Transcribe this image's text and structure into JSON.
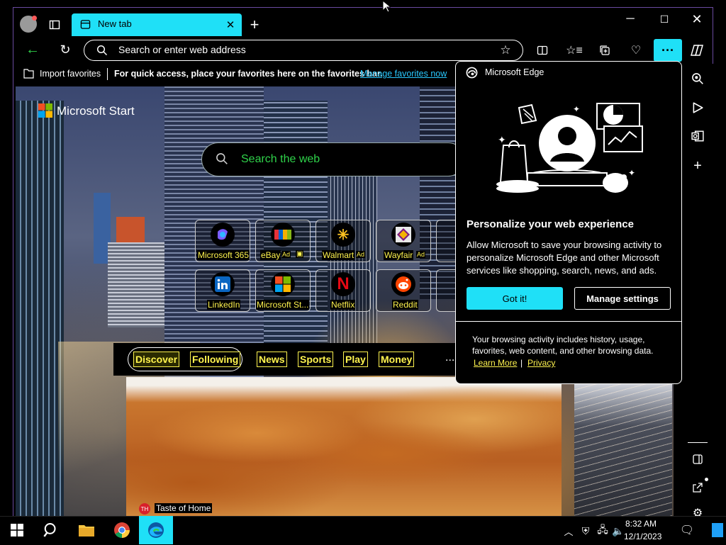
{
  "browser": {
    "tab_title": "New tab",
    "address_placeholder": "Search or enter web address"
  },
  "favorites_bar": {
    "import_label": "Import favorites",
    "message": "For quick access, place your favorites here on the favorites bar.",
    "manage_link": "Manage favorites now"
  },
  "start_page": {
    "brand": "Microsoft Start",
    "search_placeholder": "Search the web",
    "quick_links": [
      {
        "label": "Microsoft 365",
        "icon": "microsoft-365-icon",
        "ad": ""
      },
      {
        "label": "eBay",
        "icon": "ebay-icon",
        "ad": "Ad"
      },
      {
        "label": "Walmart",
        "icon": "walmart-icon",
        "ad": "Ad"
      },
      {
        "label": "Wayfair",
        "icon": "wayfair-icon",
        "ad": "Ad"
      },
      {
        "label": "LinkedIn",
        "icon": "linkedin-icon",
        "ad": ""
      },
      {
        "label": "Microsoft St...",
        "icon": "microsoft-store-icon",
        "ad": ""
      },
      {
        "label": "Netflix",
        "icon": "netflix-icon",
        "ad": ""
      },
      {
        "label": "Reddit",
        "icon": "reddit-icon",
        "ad": ""
      }
    ],
    "feed_tabs": [
      "Discover",
      "Following",
      "News",
      "Sports",
      "Play",
      "Money"
    ],
    "feed_more": "...",
    "card_source": "Taste of Home"
  },
  "popup": {
    "brand": "Microsoft Edge",
    "title": "Personalize your web experience",
    "body": "Allow Microsoft to save your browsing activity to personalize Microsoft Edge and other Microsoft services like shopping, search, news, and ads.",
    "primary_button": "Got it!",
    "secondary_button": "Manage settings",
    "note": "Your browsing activity includes history, usage, favorites, web content, and other browsing data.",
    "learn_more": "Learn More",
    "separator": "|",
    "privacy": "Privacy"
  },
  "taskbar": {
    "time": "8:32 AM",
    "date": "12/1/2023"
  },
  "colors": {
    "accent": "#1fe0f7",
    "highlight_text": "#fff44f",
    "link": "#29c9ff",
    "green": "#2fd24a"
  }
}
